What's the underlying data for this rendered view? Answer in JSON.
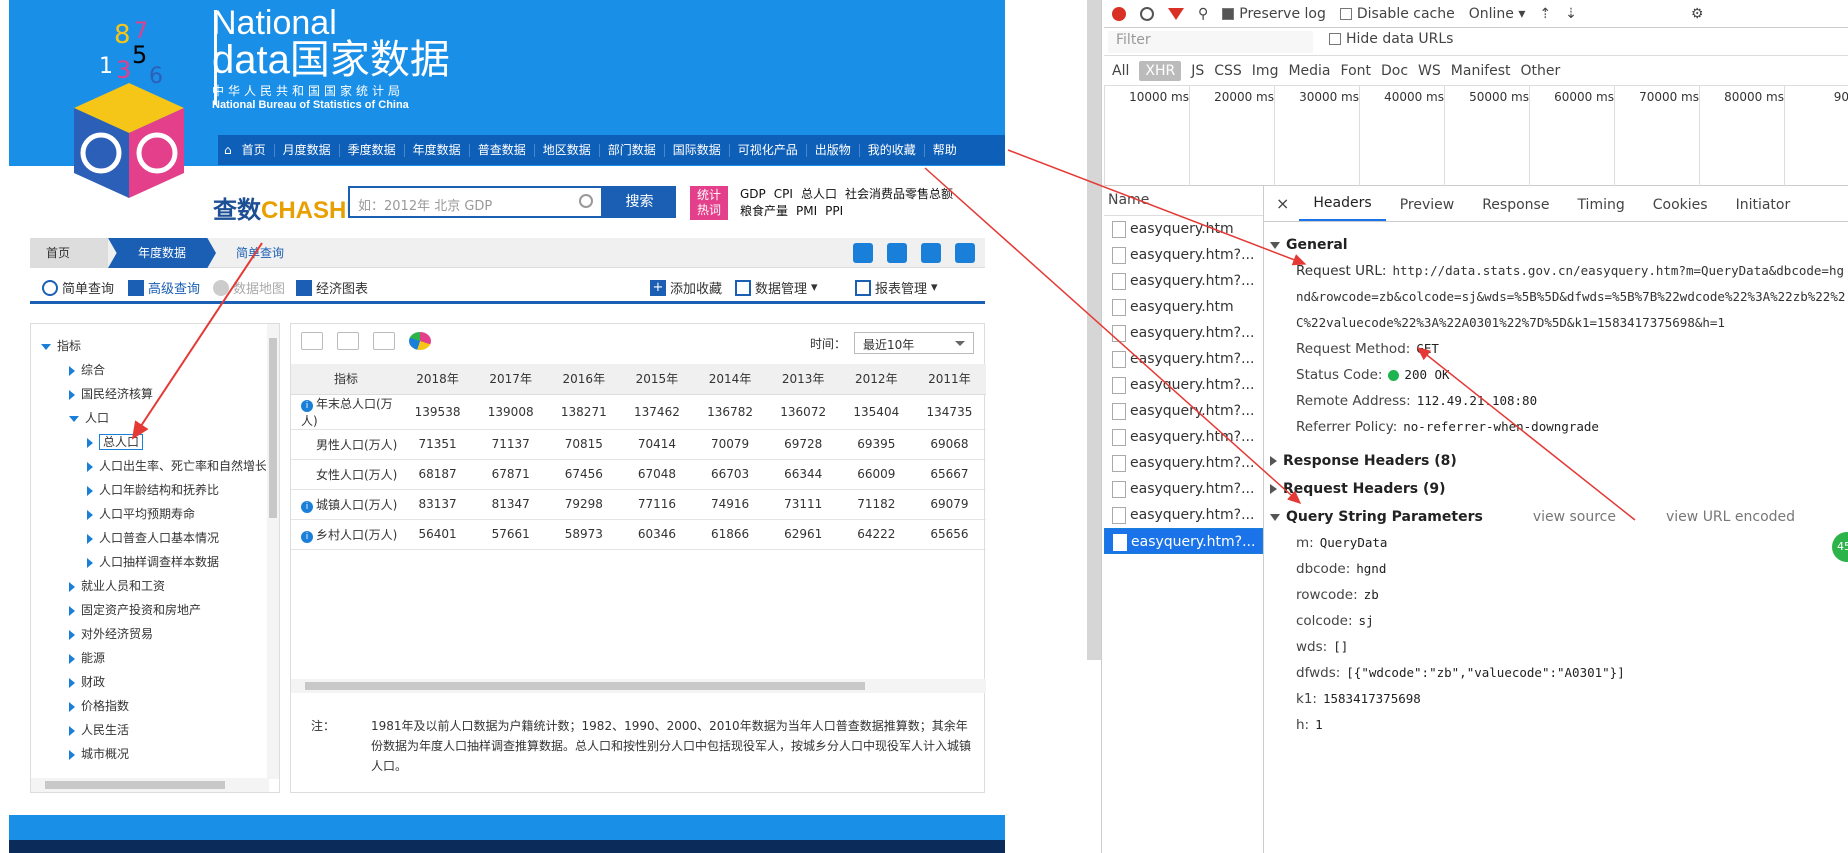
{
  "site": {
    "logo_en1": "National",
    "logo_en2": "data",
    "logo_cn": "国家数据",
    "logo_sub_cn": "中华人民共和国国家统计局",
    "logo_sub_en": "National Bureau of Statistics of China",
    "nav": [
      "首页",
      "月度数据",
      "季度数据",
      "年度数据",
      "普查数据",
      "地区数据",
      "部门数据",
      "国际数据",
      "可视化产品",
      "出版物",
      "我的收藏",
      "帮助"
    ],
    "chashu_a": "查数",
    "chashu_b": "CHASHU",
    "search_placeholder": "如：2012年 北京 GDP",
    "search_button": "搜索",
    "hot_label": "统计热词",
    "hot_words": [
      "GDP",
      "CPI",
      "总人口",
      "社会消费品零售总额",
      "粮食产量",
      "PMI",
      "PPI"
    ],
    "breadcrumb": [
      "首页",
      "年度数据",
      "简单查询"
    ],
    "tabs": [
      "简单查询",
      "高级查询",
      "数据地图",
      "经济图表"
    ],
    "tab_actions": [
      "添加收藏",
      "数据管理",
      "报表管理"
    ],
    "tree": [
      {
        "label": "指标",
        "level": 0,
        "open": true
      },
      {
        "label": "综合",
        "level": 1
      },
      {
        "label": "国民经济核算",
        "level": 1
      },
      {
        "label": "人口",
        "level": 1,
        "open": true
      },
      {
        "label": "总人口",
        "level": 2,
        "selected": true
      },
      {
        "label": "人口出生率、死亡率和自然增长率",
        "level": 2
      },
      {
        "label": "人口年龄结构和抚养比",
        "level": 2
      },
      {
        "label": "人口平均预期寿命",
        "level": 2
      },
      {
        "label": "人口普查人口基本情况",
        "level": 2
      },
      {
        "label": "人口抽样调查样本数据",
        "level": 2
      },
      {
        "label": "就业人员和工资",
        "level": 1
      },
      {
        "label": "固定资产投资和房地产",
        "level": 1
      },
      {
        "label": "对外经济贸易",
        "level": 1
      },
      {
        "label": "能源",
        "level": 1
      },
      {
        "label": "财政",
        "level": 1
      },
      {
        "label": "价格指数",
        "level": 1
      },
      {
        "label": "人民生活",
        "level": 1
      },
      {
        "label": "城市概况",
        "level": 1
      }
    ],
    "time_label": "时间：",
    "time_value": "最近10年",
    "table_headers": [
      "指标",
      "2018年",
      "2017年",
      "2016年",
      "2015年",
      "2014年",
      "2013年",
      "2012年",
      "2011年"
    ],
    "table_rows": [
      {
        "name": "年末总人口(万人)",
        "info": true,
        "values": [
          "139538",
          "139008",
          "138271",
          "137462",
          "136782",
          "136072",
          "135404",
          "134735"
        ]
      },
      {
        "name": "男性人口(万人)",
        "info": false,
        "values": [
          "71351",
          "71137",
          "70815",
          "70414",
          "70079",
          "69728",
          "69395",
          "69068"
        ]
      },
      {
        "name": "女性人口(万人)",
        "info": false,
        "values": [
          "68187",
          "67871",
          "67456",
          "67048",
          "66703",
          "66344",
          "66009",
          "65667"
        ]
      },
      {
        "name": "城镇人口(万人)",
        "info": true,
        "values": [
          "83137",
          "81347",
          "79298",
          "77116",
          "74916",
          "73111",
          "71182",
          "69079"
        ]
      },
      {
        "name": "乡村人口(万人)",
        "info": true,
        "values": [
          "56401",
          "57661",
          "58973",
          "60346",
          "61866",
          "62961",
          "64222",
          "65656"
        ]
      }
    ],
    "note_label": "注：",
    "note_text": "1981年及以前人口数据为户籍统计数；1982、1990、2000、2010年数据为当年人口普查数据推算数；其余年份数据为年度人口抽样调查推算数据。总人口和按性别分人口中包括现役军人，按城乡分人口中现役军人计入城镇人口。"
  },
  "devtools": {
    "preserve_log": "Preserve log",
    "disable_cache": "Disable cache",
    "throttle": "Online",
    "filter_placeholder": "Filter",
    "hide_data_urls": "Hide data URLs",
    "types": [
      "All",
      "XHR",
      "JS",
      "CSS",
      "Img",
      "Media",
      "Font",
      "Doc",
      "WS",
      "Manifest",
      "Other"
    ],
    "ticks": [
      "10000 ms",
      "20000 ms",
      "30000 ms",
      "40000 ms",
      "50000 ms",
      "60000 ms",
      "70000 ms",
      "80000 ms",
      "9000("
    ],
    "name_header": "Name",
    "requests": [
      "easyquery.htm",
      "easyquery.htm?...",
      "easyquery.htm?...",
      "easyquery.htm",
      "easyquery.htm?...",
      "easyquery.htm?...",
      "easyquery.htm?...",
      "easyquery.htm?...",
      "easyquery.htm?...",
      "easyquery.htm?...",
      "easyquery.htm?...",
      "easyquery.htm?...",
      "easyquery.htm?..."
    ],
    "detail_tabs": [
      "Headers",
      "Preview",
      "Response",
      "Timing",
      "Cookies",
      "Initiator"
    ],
    "general": "General",
    "request_url_label": "Request URL:",
    "request_url": "http://data.stats.gov.cn/easyquery.htm?m=QueryData&dbcode=hgnd&rowcode=zb&colcode=sj&wds=%5B%5D&dfwds=%5B%7B%22wdcode%22%3A%22zb%22%2C%22valuecode%22%3A%22A0301%22%7D%5D&k1=1583417375698&h=1",
    "method_label": "Request Method:",
    "method": "GET",
    "status_label": "Status Code:",
    "status": "200 OK",
    "remote_label": "Remote Address:",
    "remote": "112.49.21.108:80",
    "referrer_label": "Referrer Policy:",
    "referrer": "no-referrer-when-downgrade",
    "response_headers": "Response Headers (8)",
    "request_headers": "Request Headers (9)",
    "qsp": "Query String Parameters",
    "view_source": "view source",
    "view_url_encoded": "view URL encoded",
    "params": [
      {
        "k": "m:",
        "v": "QueryData"
      },
      {
        "k": "dbcode:",
        "v": "hgnd"
      },
      {
        "k": "rowcode:",
        "v": "zb"
      },
      {
        "k": "colcode:",
        "v": "sj"
      },
      {
        "k": "wds:",
        "v": "[]"
      },
      {
        "k": "dfwds:",
        "v": "[{\"wdcode\":\"zb\",\"valuecode\":\"A0301\"}]"
      },
      {
        "k": "k1:",
        "v": "1583417375698"
      },
      {
        "k": "h:",
        "v": "1"
      }
    ],
    "badge": "45"
  },
  "colors": {
    "brand": "#1a8fe8",
    "nav": "#0e5fb8",
    "accent": "#1a73e8",
    "annotation": "#e53935"
  }
}
